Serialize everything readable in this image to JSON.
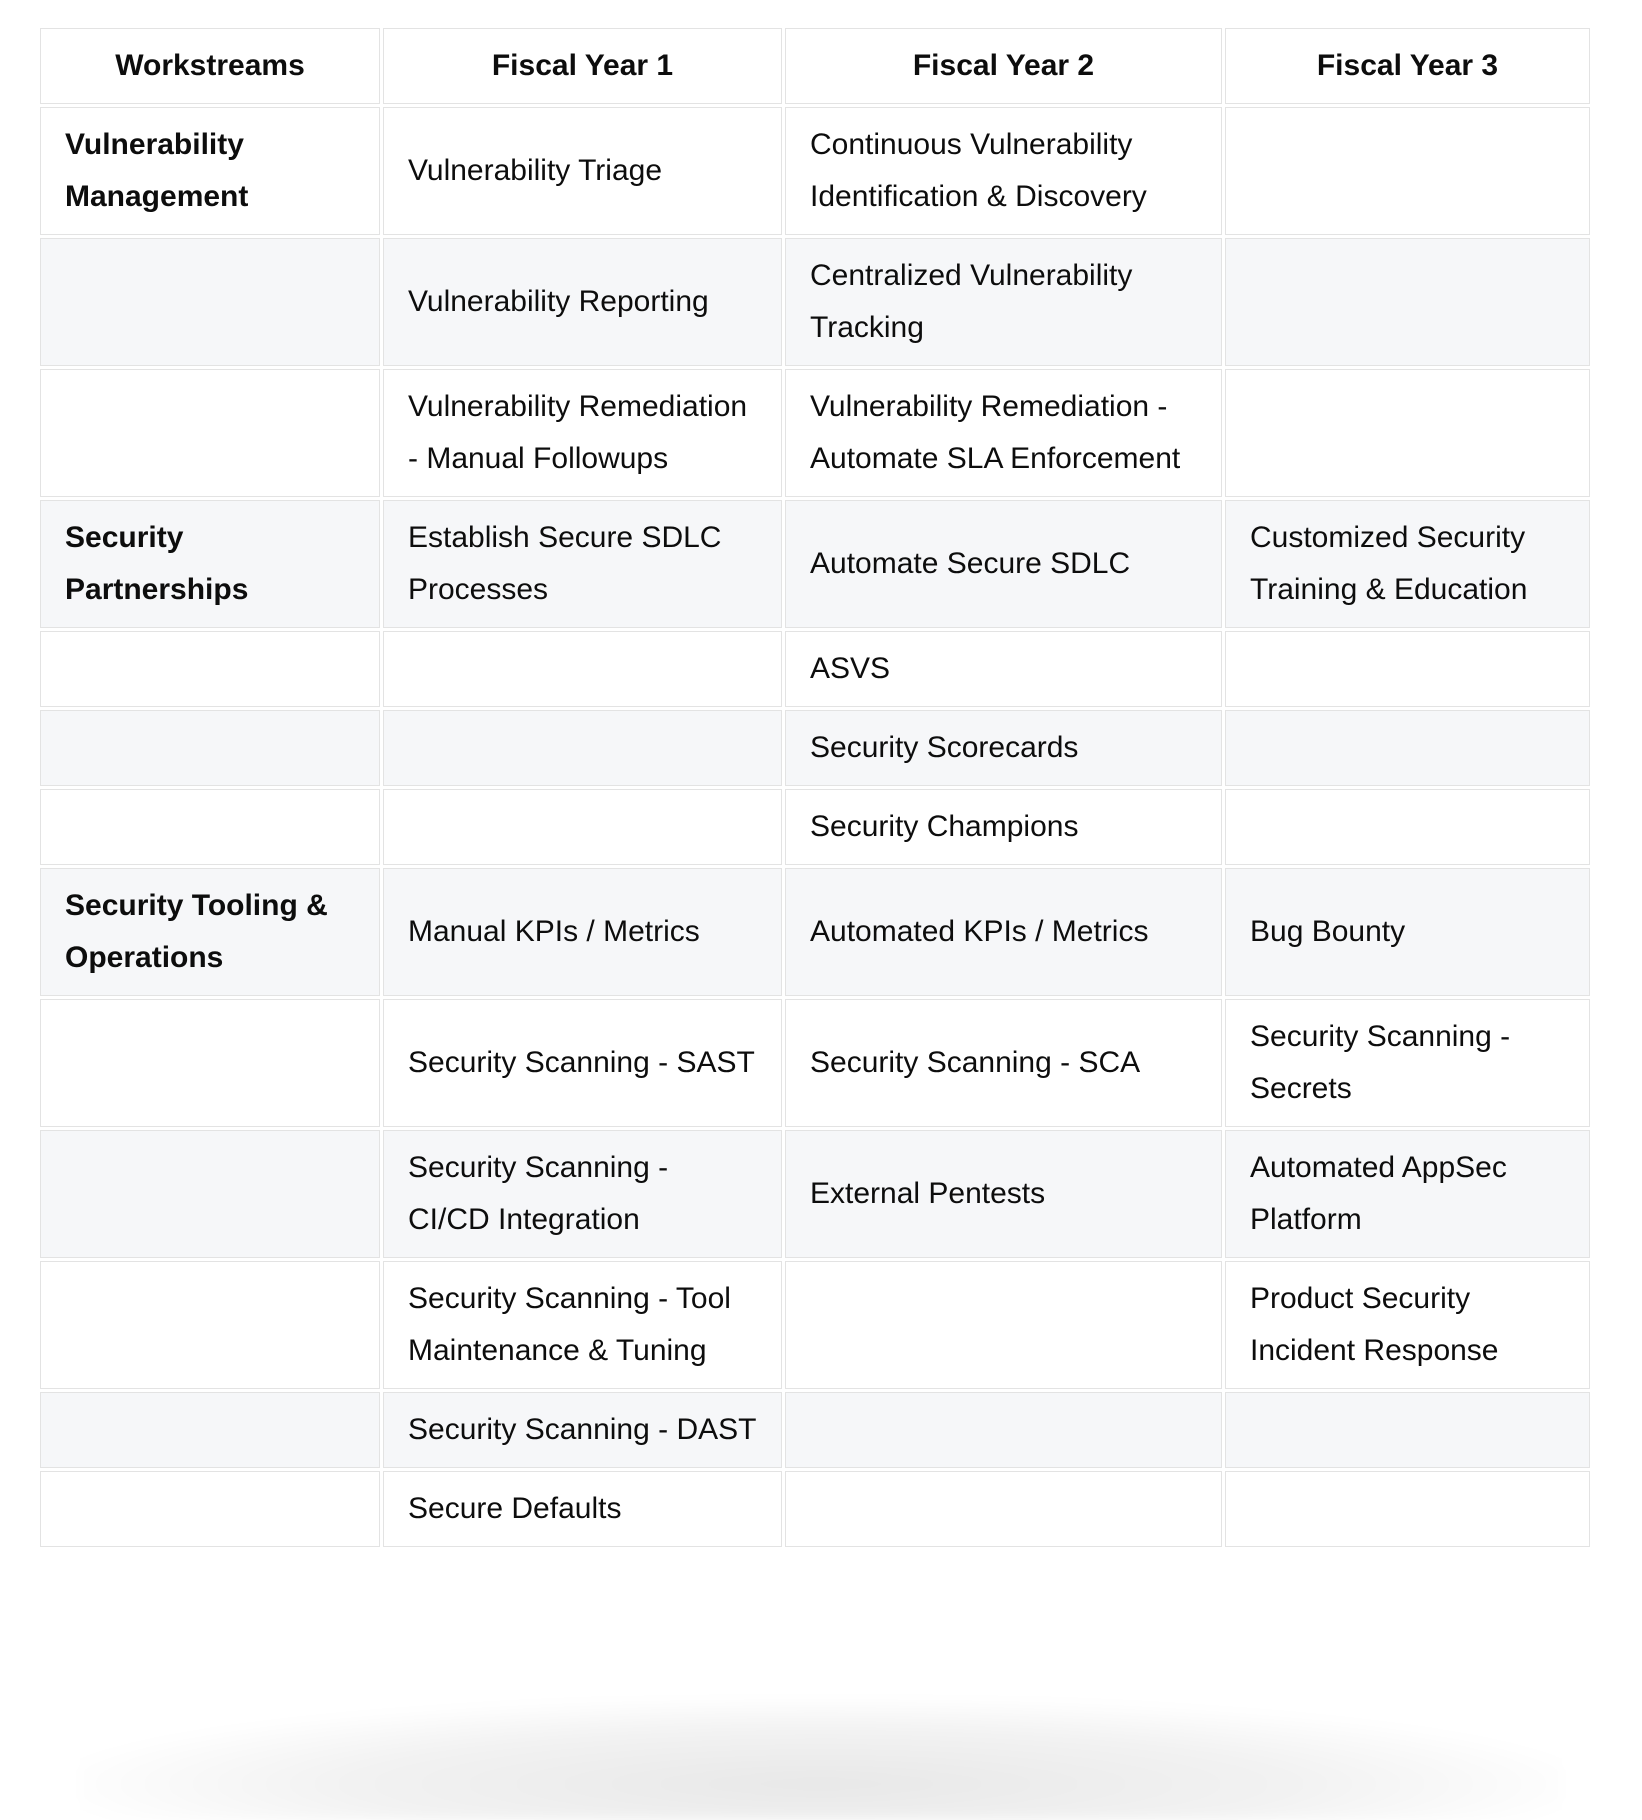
{
  "table": {
    "headers": [
      "Workstreams",
      "Fiscal Year 1",
      "Fiscal Year 2",
      "Fiscal Year 3"
    ],
    "rows": [
      [
        "Vulnerability Management",
        "Vulnerability Triage",
        "Continuous Vulnerability Identification & Discovery",
        ""
      ],
      [
        "",
        "Vulnerability Reporting",
        "Centralized Vulnerability Tracking",
        ""
      ],
      [
        "",
        "Vulnerability Remediation - Manual Followups",
        "Vulnerability Remediation - Automate SLA Enforcement",
        ""
      ],
      [
        "Security Partnerships",
        "Establish Secure SDLC Processes",
        "Automate Secure SDLC",
        "Customized Security Training & Education"
      ],
      [
        "",
        "",
        "ASVS",
        ""
      ],
      [
        "",
        "",
        "Security Scorecards",
        ""
      ],
      [
        "",
        "",
        "Security Champions",
        ""
      ],
      [
        "Security Tooling & Operations",
        "Manual KPIs / Metrics",
        "Automated KPIs / Metrics",
        "Bug Bounty"
      ],
      [
        "",
        "Security Scanning - SAST",
        "Security Scanning - SCA",
        "Security Scanning - Secrets"
      ],
      [
        "",
        "Security Scanning - CI/CD Integration",
        "External Pentests",
        "Automated AppSec Platform"
      ],
      [
        "",
        "Security Scanning - Tool Maintenance & Tuning",
        "",
        "Product Security Incident Response"
      ],
      [
        "",
        "Security Scanning - DAST",
        "",
        ""
      ],
      [
        "",
        "Secure Defaults",
        "",
        ""
      ]
    ]
  },
  "colors": {
    "text": "#0d0d0d",
    "border": "#e3e3e3",
    "row_stripe": "#f6f7f9",
    "row_base": "#ffffff"
  }
}
